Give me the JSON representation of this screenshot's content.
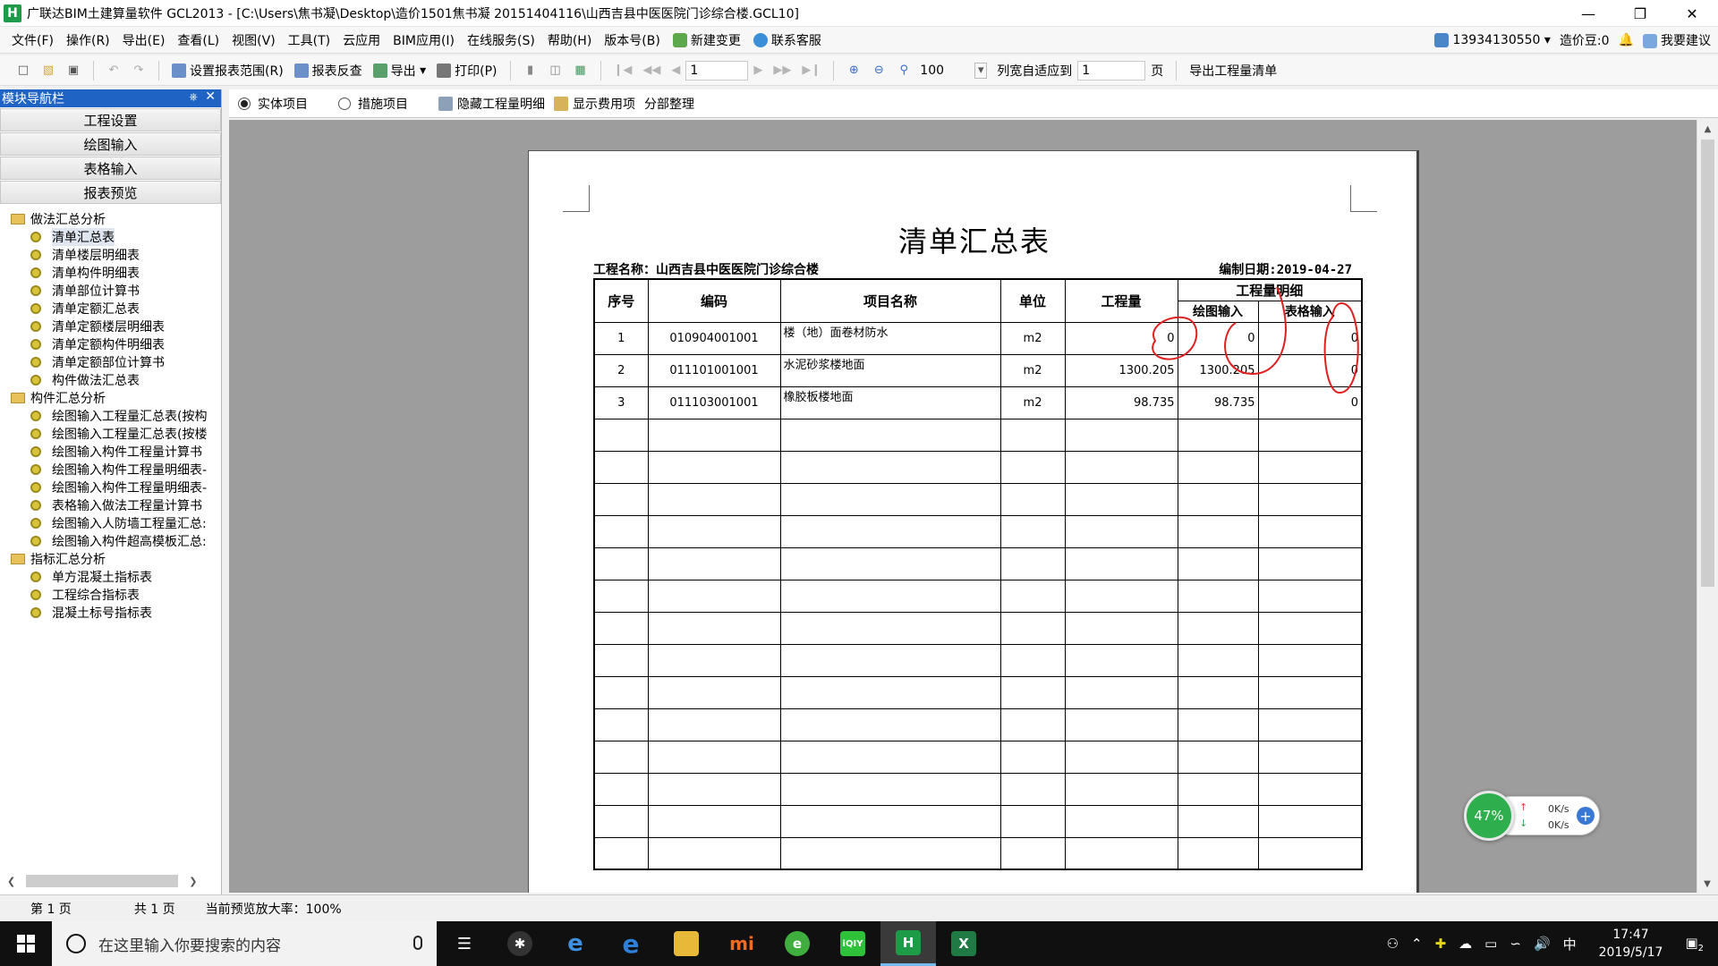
{
  "window": {
    "title": "广联达BIM土建算量软件 GCL2013 - [C:\\Users\\焦书凝\\Desktop\\造价1501焦书凝 20151404116\\山西吉县中医医院门诊综合楼.GCL10]",
    "icon_letter": "H"
  },
  "menu": {
    "items": [
      "文件(F)",
      "操作(R)",
      "导出(E)",
      "查看(L)",
      "视图(V)",
      "工具(T)",
      "云应用",
      "BIM应用(I)",
      "在线服务(S)",
      "帮助(H)",
      "版本号(B)"
    ],
    "new_change": "新建变更",
    "contact": "联系客服",
    "account": "13934130550",
    "beans": "造价豆:0",
    "suggest": "我要建议"
  },
  "toolbar": {
    "set_range": "设置报表范围(R)",
    "report_check": "报表反查",
    "export": "导出",
    "print": "打印(P)",
    "page_input": "1",
    "zoom": "100",
    "col_fit": "列宽自适应到",
    "col_fit_value": "1",
    "page_unit": "页",
    "export_list": "导出工程量清单"
  },
  "left_panel": {
    "title": "模块导航栏",
    "nav_buttons": [
      "工程设置",
      "绘图输入",
      "表格输入",
      "报表预览"
    ],
    "tree": [
      {
        "folder": "做法汇总分析",
        "items": [
          "清单汇总表",
          "清单楼层明细表",
          "清单构件明细表",
          "清单部位计算书",
          "清单定额汇总表",
          "清单定额楼层明细表",
          "清单定额构件明细表",
          "清单定额部位计算书",
          "构件做法汇总表"
        ]
      },
      {
        "folder": "构件汇总分析",
        "items": [
          "绘图输入工程量汇总表(按构",
          "绘图输入工程量汇总表(按楼",
          "绘图输入构件工程量计算书",
          "绘图输入构件工程量明细表-",
          "绘图输入构件工程量明细表-",
          "表格输入做法工程量计算书",
          "绘图输入人防墙工程量汇总:",
          "绘图输入构件超高模板汇总:"
        ]
      },
      {
        "folder": "指标汇总分析",
        "items": [
          "单方混凝土指标表",
          "工程综合指标表",
          "混凝土标号指标表"
        ]
      }
    ],
    "selected": "清单汇总表"
  },
  "options": {
    "radio_entity": "实体项目",
    "radio_measure": "措施项目",
    "hide_detail": "隐藏工程量明细",
    "show_fee": "显示费用项",
    "section_arrange": "分部整理"
  },
  "report": {
    "title": "清单汇总表",
    "project_label": "工程名称：山西吉县中医医院门诊综合楼",
    "date_label": "编制日期:2019-04-27",
    "headers": {
      "seq": "序号",
      "code": "编码",
      "name": "项目名称",
      "unit": "单位",
      "qty": "工程量",
      "detail": "工程量明细",
      "draw": "绘图输入",
      "table": "表格输入"
    },
    "rows": [
      {
        "seq": "1",
        "code": "010904001001",
        "name": "楼（地）面卷材防水",
        "unit": "m2",
        "qty": "0",
        "draw": "0",
        "table": "0"
      },
      {
        "seq": "2",
        "code": "011101001001",
        "name": "水泥砂浆楼地面",
        "unit": "m2",
        "qty": "1300.205",
        "draw": "1300.205",
        "table": "0"
      },
      {
        "seq": "3",
        "code": "011103001001",
        "name": "橡胶板楼地面",
        "unit": "m2",
        "qty": "98.735",
        "draw": "98.735",
        "table": "0"
      }
    ],
    "empty_rows": 14
  },
  "status": {
    "page": "第 1 页",
    "total": "共 1 页",
    "zoom_text": "当前预览放大率：100%"
  },
  "net_widget": {
    "percent": "47%",
    "up": "0K/s",
    "down": "0K/s"
  },
  "taskbar": {
    "search_placeholder": "在这里输入你要搜索的内容",
    "clock_time": "17:47",
    "clock_date": "2019/5/17",
    "ime": "中",
    "notif_count": "2"
  },
  "colors": {
    "accent_blue": "#1f64c4",
    "app_green": "#1e9b46",
    "annotation_red": "#e02020"
  }
}
